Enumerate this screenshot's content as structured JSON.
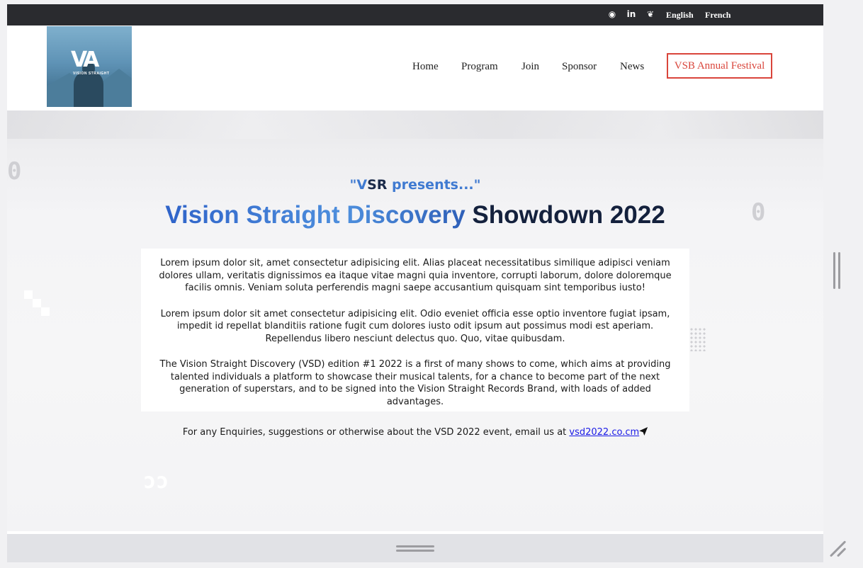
{
  "topbar": {
    "icons": [
      "github-icon",
      "linkedin-icon",
      "twitter-icon"
    ],
    "languages": [
      "English",
      "French"
    ]
  },
  "header": {
    "logo_text": "VA",
    "logo_subtext": "VISION STRAIGHT",
    "nav": [
      "Home",
      "Program",
      "Join",
      "Sponsor",
      "News"
    ],
    "cta": "VSB Annual Festival"
  },
  "hero": {
    "presents_quote_open": "\"",
    "presents_v": "V",
    "presents_sr": "SR",
    "presents_word": "presents...\"",
    "title_part1": "Vision Straight Discovery",
    "title_part2": "Showdown 2022",
    "paragraphs": [
      "Lorem ipsum dolor sit, amet consectetur adipisicing elit. Alias placeat necessitatibus similique adipisci veniam dolores ullam, veritatis dignissimos ea itaque vitae magni quia inventore, corrupti laborum, dolore doloremque facilis omnis. Veniam soluta perferendis magni saepe accusantium quisquam sint temporibus iusto!",
      "Lorem ipsum dolor sit amet consectetur adipisicing elit. Odio eveniet officia esse optio inventore fugiat ipsam, impedit id repellat blanditiis ratione fugit cum dolores iusto odit ipsum aut possimus modi est aperiam. Repellendus libero nesciunt delectus quo. Quo, vitae quibusdam.",
      "The Vision Straight Discovery (VSD) edition #1 2022 is a first of many shows to come, which aims at providing talented individuals a platform to showcase their musical talents, for a chance to become part of the next generation of superstars, and to be signed into the Vision Straight Records Brand, with loads of added advantages."
    ],
    "enquiry_text": "For any Enquiries, suggestions or otherwise about the VSD 2022 event, email us at ",
    "enquiry_link": "vsd2022.co.cm",
    "deco_digits": [
      "0",
      "0",
      "ɔɔ"
    ]
  },
  "colors": {
    "topbar": "#2a2b2f",
    "accent_red": "#d9453b",
    "title_blue": "#2f63c9",
    "title_navy": "#14213d"
  }
}
